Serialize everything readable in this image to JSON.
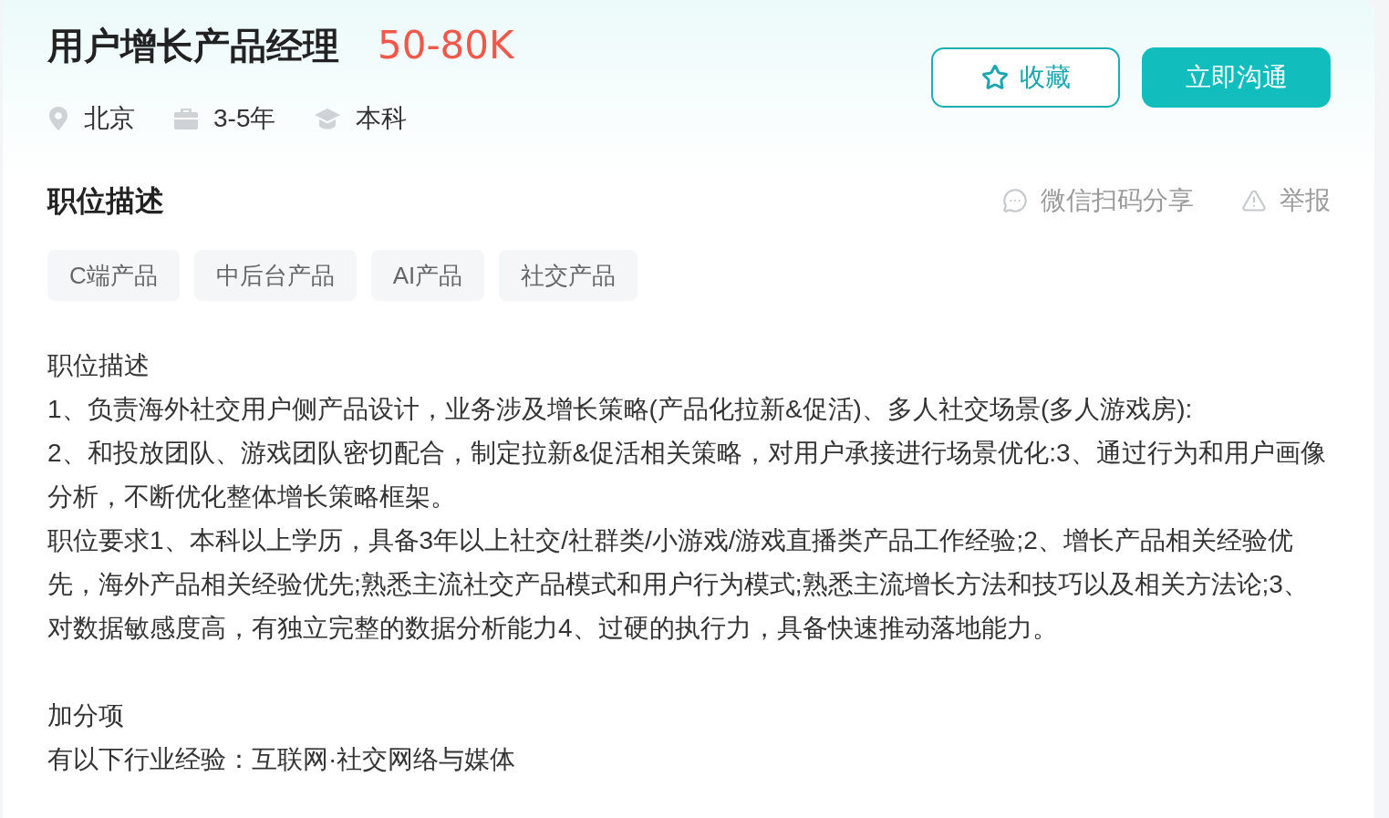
{
  "job": {
    "title": "用户增长产品经理",
    "salary": "50-80K",
    "meta": [
      {
        "kind": "location",
        "text": "北京"
      },
      {
        "kind": "experience",
        "text": "3-5年"
      },
      {
        "kind": "degree",
        "text": "本科"
      }
    ]
  },
  "actions": [
    {
      "kind": "favorite",
      "label": "收藏"
    },
    {
      "kind": "chat",
      "label": "立即沟通"
    }
  ],
  "section": {
    "title": "职位描述",
    "links": [
      {
        "kind": "share",
        "label": "微信扫码分享"
      },
      {
        "kind": "report",
        "label": "举报"
      }
    ],
    "tags": [
      "C端产品",
      "中后台产品",
      "AI产品",
      "社交产品"
    ],
    "blocks": [
      [
        "职位描述",
        "1、负责海外社交用户侧产品设计，业务涉及增长策略(产品化拉新&促活)、多人社交场景(多人游戏房):",
        "2、和投放团队、游戏团队密切配合，制定拉新&促活相关策略，对用户承接进行场景优化:3、通过行为和用户画像分析，不断优化整体增长策略框架。",
        "职位要求1、本科以上学历，具备3年以上社交/社群类/小游戏/游戏直播类产品工作经验;2、增长产品相关经验优先，海外产品相关经验优先;熟悉主流社交产品模式和用户行为模式;熟悉主流增长方法和技巧以及相关方法论;3、对数据敏感度高，有独立完整的数据分析能力4、过硬的执行力，具备快速推动落地能力。"
      ],
      [
        "加分项",
        "有以下行业经验：互联网·社交网络与媒体"
      ]
    ]
  }
}
